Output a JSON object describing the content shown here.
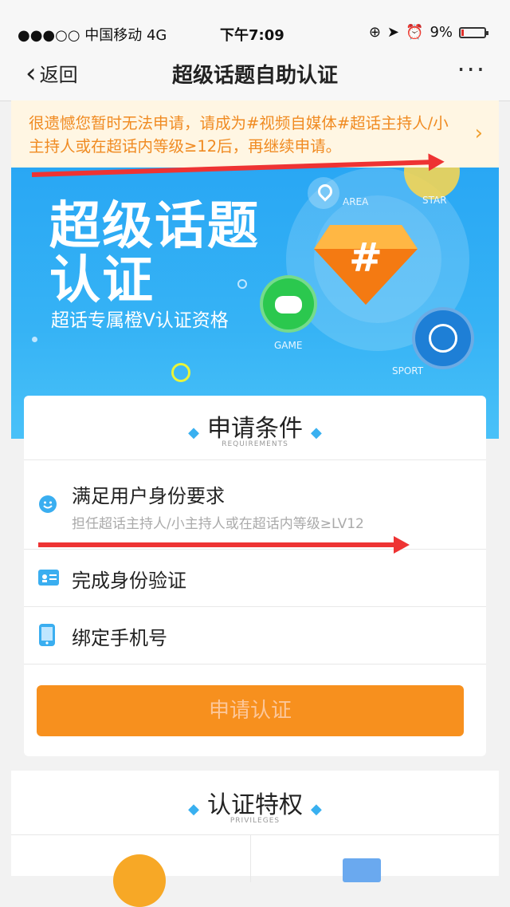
{
  "status_bar": {
    "carrier": "●●●○○ 中国移动  4G",
    "time": "下午7:09",
    "battery": "9%",
    "battery_level": 0.09
  },
  "nav": {
    "back_label": "返回",
    "title": "超级话题自助认证",
    "more_label": "···"
  },
  "notice": {
    "text": "很遗憾您暂时无法申请，请成为#视频自媒体#超话主持人/小主持人或在超话内等级≥12后，再继续申请。"
  },
  "hero": {
    "title_line1": "超级话题",
    "title_line2": "认证",
    "subtitle": "超话专属橙V认证资格",
    "badges": {
      "area": "AREA",
      "star": "STAR",
      "game": "GAME",
      "sport": "SPORT"
    },
    "diamond_symbol": "#"
  },
  "requirements": {
    "heading": "申请条件",
    "heading_en": "REQUIREMENTS",
    "items": [
      {
        "icon": "smiley-icon",
        "label": "满足用户身份要求",
        "detail": "担任超话主持人/小主持人或在超话内等级≥LV12"
      },
      {
        "icon": "id-card-icon",
        "label": "完成身份验证"
      },
      {
        "icon": "phone-icon",
        "label": "绑定手机号"
      }
    ],
    "apply_button": "申请认证"
  },
  "privileges": {
    "heading": "认证特权",
    "heading_en": "PRIVILEGES"
  },
  "colors": {
    "hero_blue": "#29a7f4",
    "accent_orange": "#f7901e",
    "notice_text": "#f08b22",
    "arrow_red": "#e33333"
  }
}
